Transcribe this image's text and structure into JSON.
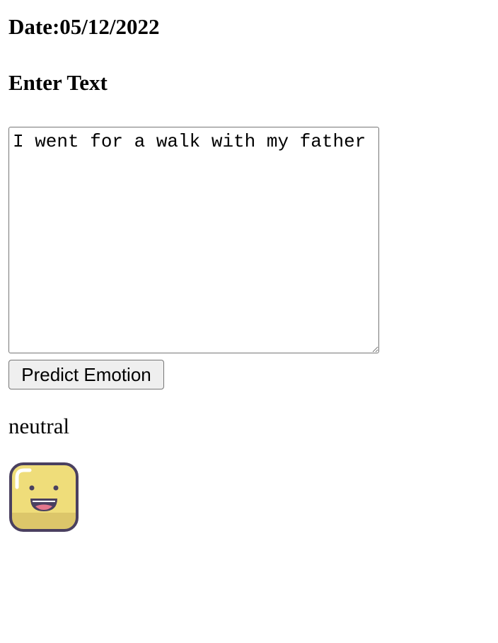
{
  "header": {
    "date_label": "Date:05/12/2022",
    "section_title": "Enter Text"
  },
  "form": {
    "text_value": "I went for a walk with my father",
    "predict_button_label": "Predict Emotion"
  },
  "result": {
    "emotion_label": "neutral",
    "emoji_icon": "smiling-face-icon",
    "emoji_color": "#efdd7a",
    "emoji_outline_color": "#4a4060"
  }
}
